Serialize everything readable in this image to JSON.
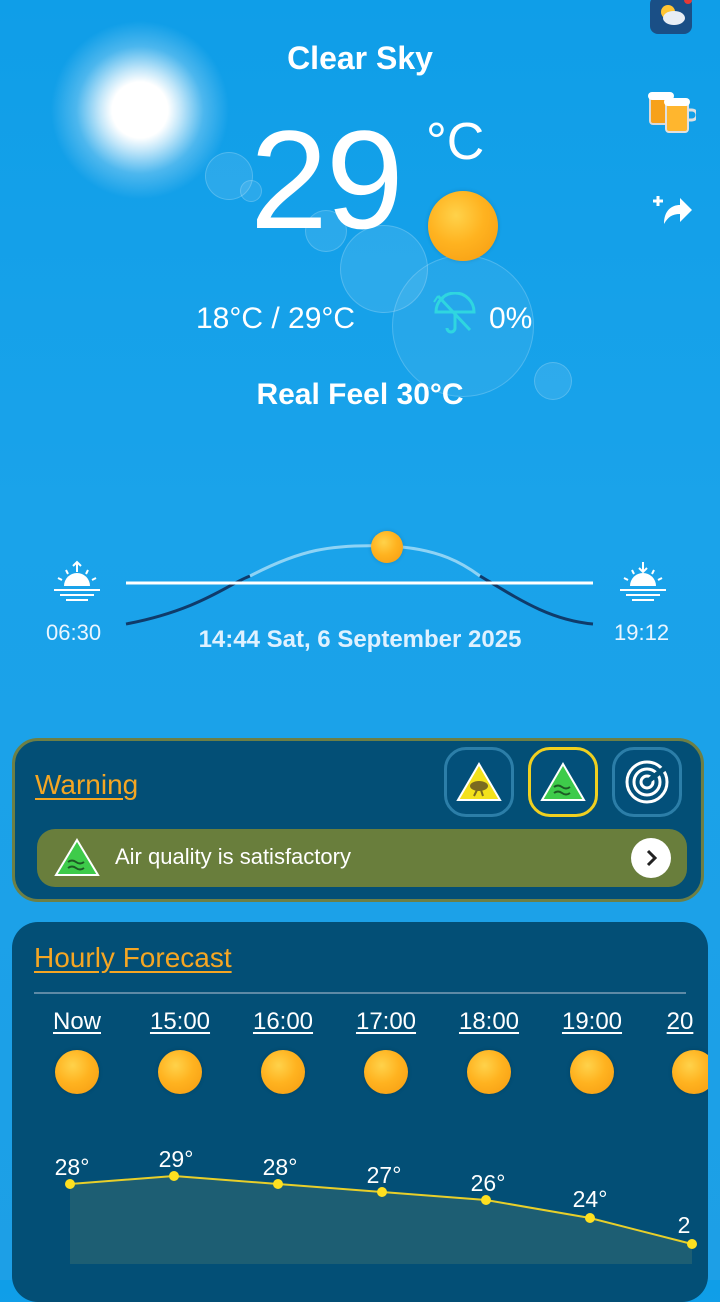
{
  "current": {
    "condition": "Clear Sky",
    "temperature": "29",
    "unit": "°C",
    "min_max": "18°C  /  29°C",
    "precip_chance": "0%",
    "real_feel": "Real Feel 30°C"
  },
  "sun": {
    "sunrise": "06:30",
    "sunset": "19:12",
    "datetime": "14:44 Sat, 6 September 2025"
  },
  "warning": {
    "title": "Warning",
    "air_quality_text": "Air quality is satisfactory"
  },
  "hourly": {
    "title": "Hourly Forecast",
    "hours": [
      {
        "time": "Now",
        "temp": "28°"
      },
      {
        "time": "15:00",
        "temp": "29°"
      },
      {
        "time": "16:00",
        "temp": "28°"
      },
      {
        "time": "17:00",
        "temp": "27°"
      },
      {
        "time": "18:00",
        "temp": "26°"
      },
      {
        "time": "19:00",
        "temp": "24°"
      },
      {
        "time": "20",
        "temp": "2"
      }
    ]
  },
  "colors": {
    "accent_orange": "#f5a623",
    "card_bg": "#034f76",
    "air_quality_bar": "#697e3c"
  },
  "icons": [
    "weather-widget-icon",
    "beer-icon",
    "share-icon",
    "sun-icon",
    "umbrella-icon",
    "sunrise-icon",
    "sunset-icon",
    "storm-warning-icon",
    "air-quality-icon",
    "radar-icon",
    "chevron-right-icon"
  ]
}
